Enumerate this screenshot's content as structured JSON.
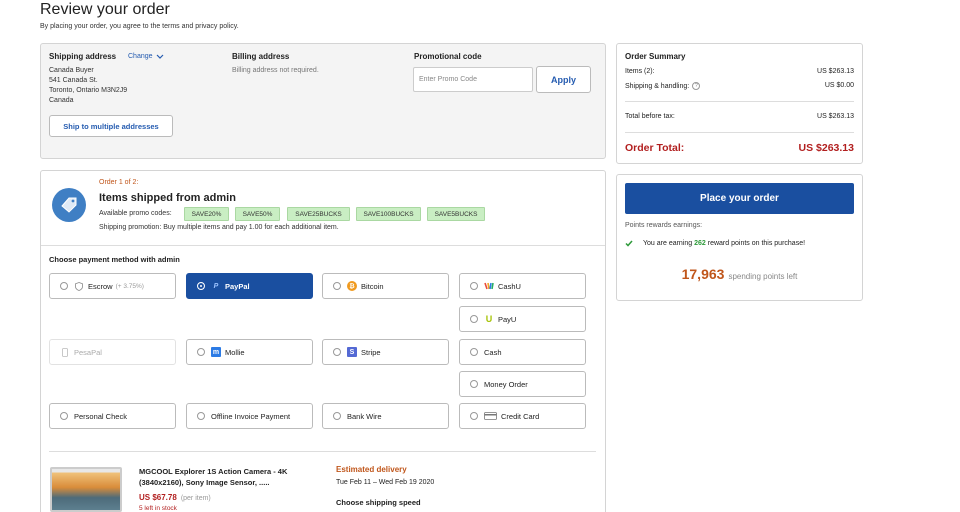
{
  "page": {
    "title": "Review your order",
    "subtitle": "By placing your order, you agree to the terms and privacy policy."
  },
  "shipping": {
    "label": "Shipping address",
    "change_label": "Change",
    "name": "Canada Buyer",
    "street": "541 Canada St.",
    "city": "Toronto, Ontario M3N2J9",
    "country": "Canada",
    "multi_button": "Ship to multiple addresses"
  },
  "billing": {
    "label": "Billing address",
    "note": "Billing address not required."
  },
  "promo": {
    "label": "Promotional code",
    "placeholder": "Enter Promo Code",
    "apply_label": "Apply"
  },
  "summary": {
    "title": "Order Summary",
    "items_label": "Items (2):",
    "items_value": "US $263.13",
    "shipping_label": "Shipping & handling:",
    "shipping_value": "US $0.00",
    "before_tax_label": "Total before tax:",
    "before_tax_value": "US $263.13",
    "total_label": "Order Total:",
    "total_value": "US $263.13"
  },
  "place_order": {
    "button": "Place your order",
    "points_label": "Points rewards earnings:",
    "earning_prefix": "You are earning ",
    "earning_points": "262",
    "earning_suffix": " reward points on this purchase!",
    "spending_points": "17,963",
    "spending_label": "spending points left"
  },
  "order": {
    "order_of": "Order 1 of 2:",
    "seller_title": "Items shipped from admin",
    "promo_codes_label": "Available promo codes:",
    "promo_codes": [
      "SAVE20%",
      "SAVE50%",
      "SAVE25BUCKS",
      "SAVE100BUCKS",
      "SAVE5BUCKS"
    ],
    "shipping_promo": "Shipping promotion: Buy multiple items and pay 1.00 for each additional item.",
    "payment_title": "Choose payment method with admin"
  },
  "payment_methods": {
    "escrow": "Escrow",
    "escrow_fee": "(+ 3.75%)",
    "paypal": "PayPal",
    "bitcoin": "Bitcoin",
    "cashu": "CashU",
    "payu": "PayU",
    "pesapal": "PesaPal",
    "mollie": "Mollie",
    "stripe": "Stripe",
    "cash": "Cash",
    "money_order": "Money Order",
    "personal_check": "Personal Check",
    "offline_invoice": "Offline Invoice Payment",
    "bank_wire": "Bank Wire",
    "credit_card": "Credit Card",
    "selected": "PayPal"
  },
  "item": {
    "title_line1": "MGCOOL Explorer 1S Action Camera - 4K",
    "title_line2": "(3840x2160), Sony Image Sensor, .....",
    "price": "US $67.78",
    "per_item": "(per item)",
    "stock": "5 left in stock",
    "delivery_label": "Estimated delivery",
    "delivery_dates": "Tue Feb 11 – Wed Feb 19 2020",
    "shipping_speed": "Choose shipping speed"
  },
  "colors": {
    "accent": "#1a4fa0",
    "total_red": "#b21f1f",
    "orange": "#c0561b",
    "green": "#2e9a3a"
  }
}
